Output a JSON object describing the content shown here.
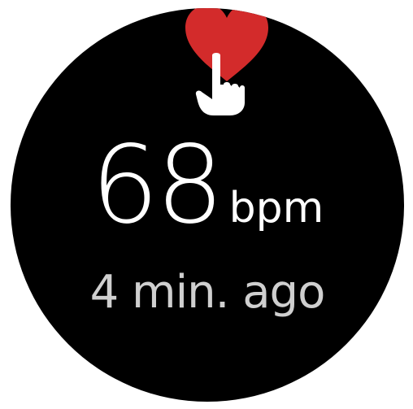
{
  "heart_rate": {
    "value": "68",
    "unit": "bpm",
    "last_measured": "4 min. ago"
  },
  "icons": {
    "measure": "heart-icon",
    "touch": "pointing-hand-icon"
  },
  "colors": {
    "background": "#000000",
    "heart": "#d32b2b",
    "text_primary": "#ffffff",
    "text_secondary": "#cfcfcf"
  }
}
